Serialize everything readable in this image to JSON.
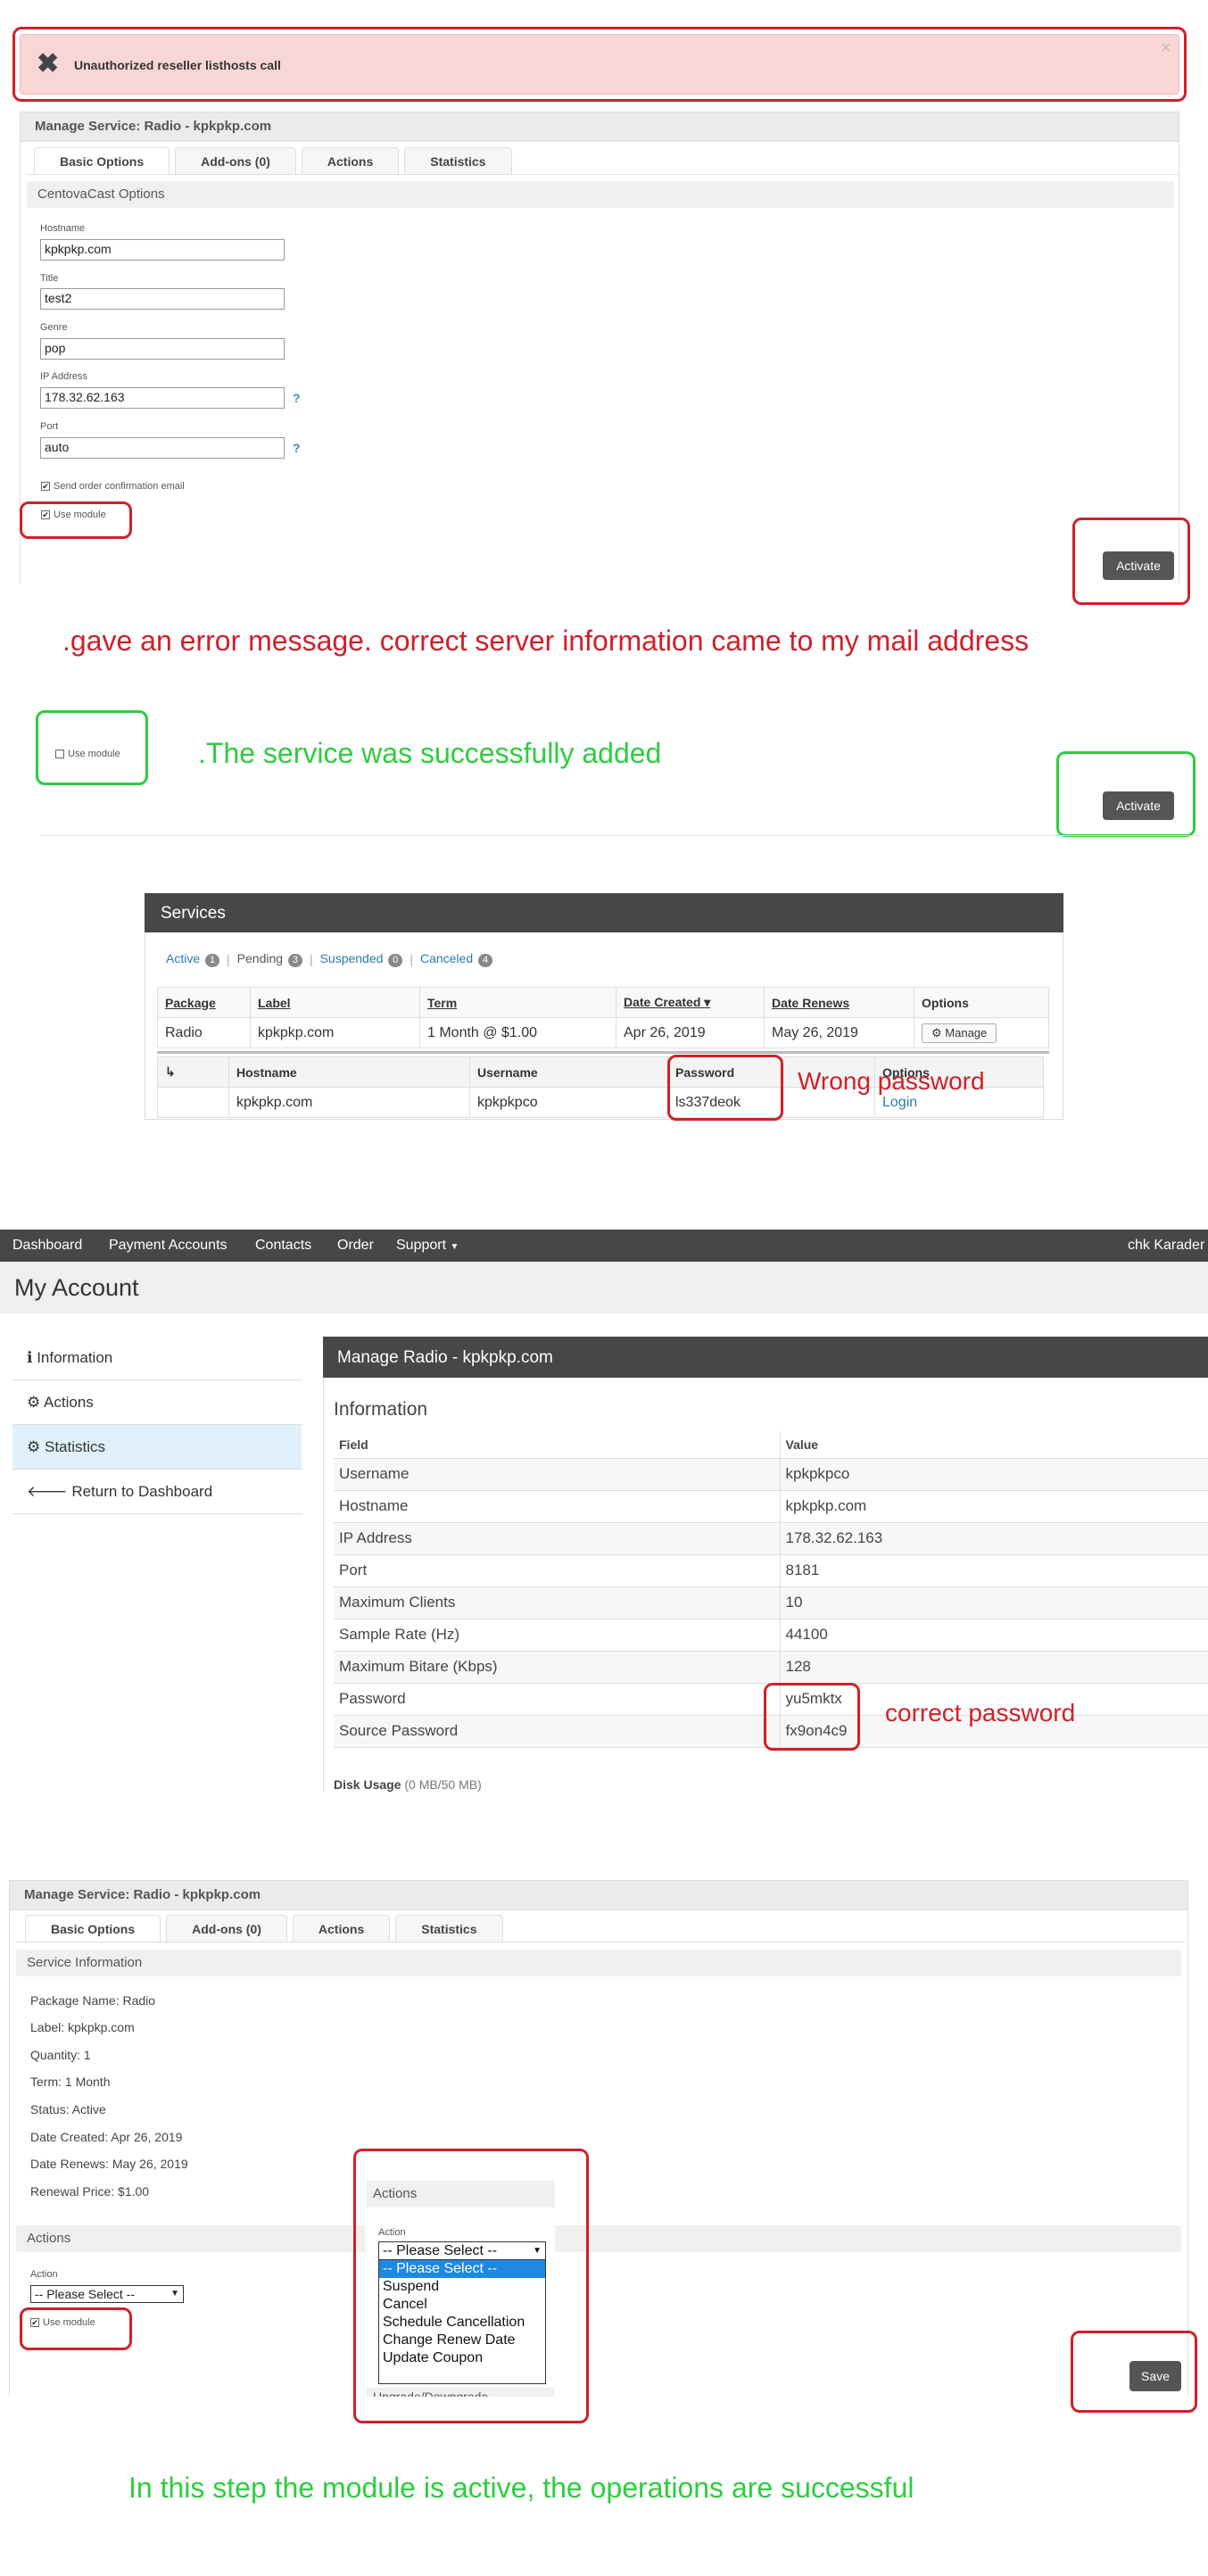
{
  "alert": {
    "message": "Unauthorized reseller listhosts call",
    "close": "×"
  },
  "section1": {
    "title": "Manage Service: Radio - kpkpkp.com",
    "tabs": [
      "Basic Options",
      "Add-ons (0)",
      "Actions",
      "Statistics"
    ],
    "options_title": "CentovaCast Options",
    "fields": {
      "hostname_label": "Hostname",
      "hostname": "kpkpkp.com",
      "title_label": "Title",
      "title": "test2",
      "genre_label": "Genre",
      "genre": "pop",
      "ip_label": "IP Address",
      "ip": "178.32.62.163",
      "port_label": "Port",
      "port": "auto",
      "qmark": "?"
    },
    "send_confirm": "Send order confirmation email",
    "use_module": "Use module",
    "activate": "Activate"
  },
  "annotation1": ".gave an error message. correct server information came to my mail address",
  "section2": {
    "use_module": "Use module",
    "activate": "Activate"
  },
  "annotation2": ".The service was successfully added",
  "services": {
    "title": "Services",
    "filters": [
      {
        "label": "Active",
        "count": "1"
      },
      {
        "label": "Pending",
        "count": "3"
      },
      {
        "label": "Suspended",
        "count": "0"
      },
      {
        "label": "Canceled",
        "count": "4"
      }
    ],
    "separator": "|",
    "headers": [
      "Package",
      "Label",
      "Term",
      "Date Created ▾",
      "Date Renews",
      "Options"
    ],
    "row": [
      "Radio",
      "kpkpkp.com",
      "1 Month @ $1.00",
      "Apr 26, 2019",
      "May 26, 2019"
    ],
    "manage": "Manage",
    "sub_arrow": "↳",
    "sub_headers": [
      "Hostname",
      "Username",
      "Password",
      "Options"
    ],
    "sub_row": [
      "kpkpkp.com",
      "kpkpkpco",
      "ls337deok"
    ],
    "login": "Login"
  },
  "annotation3": "Wrong password",
  "navbar": {
    "items": [
      "Dashboard",
      "Payment Accounts",
      "Contacts",
      "Order"
    ],
    "support": "Support",
    "user": "chk Karader"
  },
  "account": {
    "title": "My Account",
    "sidebar": [
      "Information",
      "Actions",
      "Statistics",
      "Return to Dashboard"
    ],
    "panel_title": "Manage Radio - kpkpkp.com",
    "info_title": "Information",
    "headers": [
      "Field",
      "Value"
    ],
    "rows": [
      [
        "Username",
        "kpkpkpco"
      ],
      [
        "Hostname",
        "kpkpkp.com"
      ],
      [
        "IP Address",
        "178.32.62.163"
      ],
      [
        "Port",
        "8181"
      ],
      [
        "Maximum Clients",
        "10"
      ],
      [
        "Sample Rate (Hz)",
        "44100"
      ],
      [
        "Maximum Bitare (Kbps)",
        "128"
      ],
      [
        "Password",
        "yu5mktx"
      ],
      [
        "Source Password",
        "fx9on4c9"
      ]
    ],
    "disk_label": "Disk Usage",
    "disk_value": "(0 MB/50 MB)"
  },
  "annotation4": "correct password",
  "section4": {
    "title": "Manage Service: Radio - kpkpkp.com",
    "tabs": [
      "Basic Options",
      "Add-ons (0)",
      "Actions",
      "Statistics"
    ],
    "info_title": "Service Information",
    "lines": [
      "Package Name: Radio",
      "Label: kpkpkp.com",
      "Quantity: 1",
      "Term: 1 Month",
      "Status: Active",
      "Date Created: Apr 26, 2019",
      "Date Renews: May 26, 2019",
      "Renewal Price: $1.00"
    ],
    "actions_title": "Actions",
    "action_label": "Action",
    "select_value": "-- Please Select --",
    "use_module": "Use module",
    "save": "Save",
    "popup": {
      "title": "Actions",
      "action_label": "Action",
      "select_value": "-- Please Select --",
      "options": [
        "-- Please Select --",
        "Suspend",
        "Cancel",
        "Schedule Cancellation",
        "Change Renew Date",
        "Update Coupon"
      ],
      "cut_label": "Upgrade/Downgrade"
    }
  },
  "annotation5": "In this step the module is active, the operations are successful"
}
